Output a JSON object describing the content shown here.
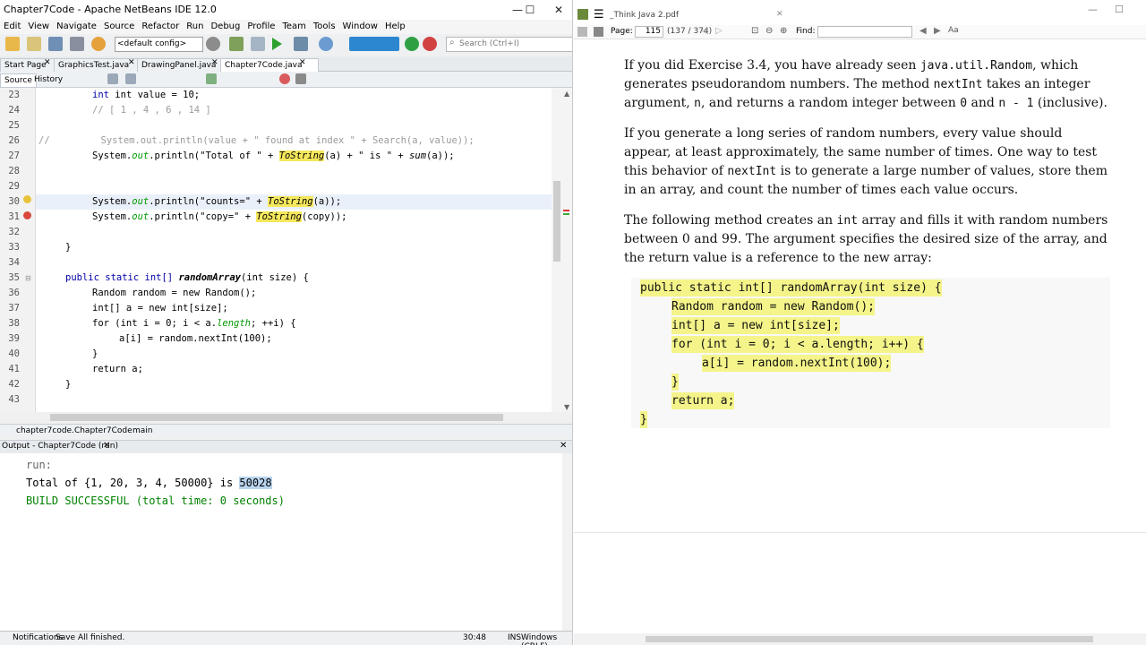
{
  "netbeans": {
    "title": "Chapter7Code - Apache NetBeans IDE 12.0",
    "window_controls": [
      "—",
      "☐",
      "✕"
    ],
    "menu": [
      "Edit",
      "View",
      "Navigate",
      "Source",
      "Refactor",
      "Run",
      "Debug",
      "Profile",
      "Team",
      "Tools",
      "Window",
      "Help"
    ],
    "config_select": "<default config>",
    "search_placeholder": "Search (Ctrl+I)",
    "tabs": [
      "Start Page",
      "GraphicsTest.java",
      "DrawingPanel.java",
      "Chapter7Code.java"
    ],
    "active_tab": "Chapter7Code.java",
    "source_tabs": [
      "Source",
      "History"
    ],
    "line_numbers": [
      "23",
      "24",
      "25",
      "26",
      "27",
      "28",
      "29",
      "30",
      "31",
      "32",
      "33",
      "34",
      "35",
      "36",
      "37",
      "38",
      "39",
      "40",
      "41",
      "42",
      "43"
    ],
    "code": {
      "l23": "int value = 10;",
      "l24": "// [ 1 , 4 , 6 , 14 ]",
      "l26": "//         System.out.println(value + \" found at index \" + Search(a, value));",
      "l27a": "System.",
      "l27b": "out",
      "l27c": ".println(\"Total of \" + ",
      "l27d": "ToString",
      "l27e": "(a) + \" is \" + ",
      "l27f": "sum",
      "l27g": "(a));",
      "l30a": "System.",
      "l30b": "out",
      "l30c": ".println(\"counts=\" + ",
      "l30d": "ToString",
      "l30e": "(a));",
      "l31a": "System.",
      "l31b": "out",
      "l31c": ".println(\"copy=\" + ",
      "l31d": "ToString",
      "l31e": "(copy));",
      "l33": "}",
      "l35a": "public static int[] ",
      "l35b": "randomArray",
      "l35c": "(int size) {",
      "l36": "Random random = new Random();",
      "l37": "int[] a = new int[size];",
      "l38a": "for (int i = 0; i < a.",
      "l38b": "length",
      "l38c": "; ++i) {",
      "l39": "a[i] = random.nextInt(100);",
      "l40": "}",
      "l41": "return a;",
      "l42": "}"
    },
    "breadcrumb": [
      "chapter7code.Chapter7Code",
      "main"
    ],
    "output_title": "Output - Chapter7Code (run)",
    "output": {
      "run": "run:",
      "total_prefix": "Total of {1, 20, 3, 4, 50000} is ",
      "total_value": "50028",
      "build": "BUILD SUCCESSFUL (total time: 0 seconds)"
    },
    "status": {
      "notifications": "Notifications",
      "message": "Save All finished.",
      "position": "30:48",
      "mode": "INS",
      "line_ending": "Windows (CRLF)"
    }
  },
  "pdf": {
    "title": "_Think Java 2.pdf",
    "page_label": "Page:",
    "page_value": "115",
    "page_of": "(137 / 374)",
    "find_label": "Find:",
    "para1": {
      "a": "If you did Exercise 3.4, you have already seen ",
      "b": "java.util.Random",
      "c": ", which generates pseudorandom numbers. The method ",
      "d": "nextInt",
      "e": " takes an integer argument, ",
      "f": "n",
      "g": ", and returns a random integer between ",
      "h": "0",
      "i": " and ",
      "j": "n - 1",
      "k": " (inclusive)."
    },
    "para2": {
      "a": "If you generate a long series of random numbers, every value should appear, at least approximately, the same number of times. One way to test this behavior of ",
      "b": "nextInt",
      "c": " is to generate a large number of values, store them in an array, and count the number of times each value occurs."
    },
    "para3": {
      "a": "The following method creates an ",
      "b": "int",
      "c": " array and fills it with random numbers between 0 and 99. The argument specifies the desired size of the array, and the return value is a reference to the new array:"
    },
    "code": [
      "public static int[] randomArray(int size) {",
      "Random random = new Random();",
      "int[] a = new int[size];",
      "for (int i = 0; i < a.length; i++) {",
      "a[i] = random.nextInt(100);",
      "}",
      "return a;",
      "}"
    ]
  },
  "colors": {
    "keyword": "#0000a8",
    "string": "#ce7b00",
    "comment": "#9a9a9a",
    "field": "#009900",
    "highlight": "#f6e85c",
    "pdf_highlight": "#f4f48a",
    "build_ok": "#008000"
  }
}
